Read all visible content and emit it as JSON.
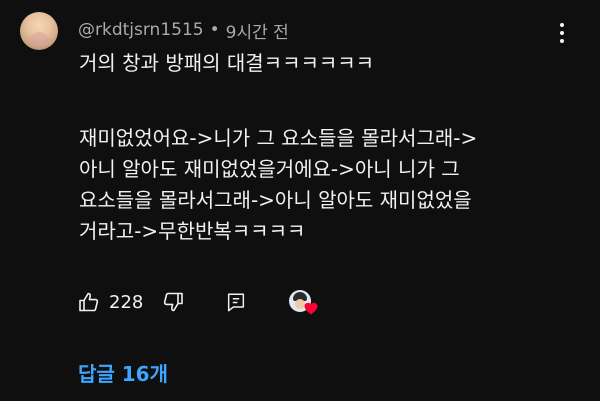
{
  "comment": {
    "author_handle": "@rkdtjsrn1515",
    "separator": "•",
    "time_ago": "9시간 전",
    "text_lines": [
      "거의 창과 방패의 대결ㅋㅋㅋㅋㅋㅋ",
      "",
      "재미없었어요->니가 그 요소들을 몰라서그래->",
      "아니 알아도 재미없었을거에요->아니 니가 그",
      "요소들을 몰라서그래->아니 알아도 재미없었을",
      "거라고->무한반복ㅋㅋㅋㅋ"
    ]
  },
  "actions": {
    "like_count": "228",
    "icons": [
      "thumbs-up-icon",
      "thumbs-down-icon",
      "reply-icon",
      "creator-heart-icon"
    ],
    "heart_color": "#ff0033"
  },
  "replies": {
    "label": "답글 16개"
  },
  "colors": {
    "background": "#0f0f0f",
    "text": "#f1f1f1",
    "muted": "#aaaaaa",
    "link": "#3ea6ff"
  }
}
